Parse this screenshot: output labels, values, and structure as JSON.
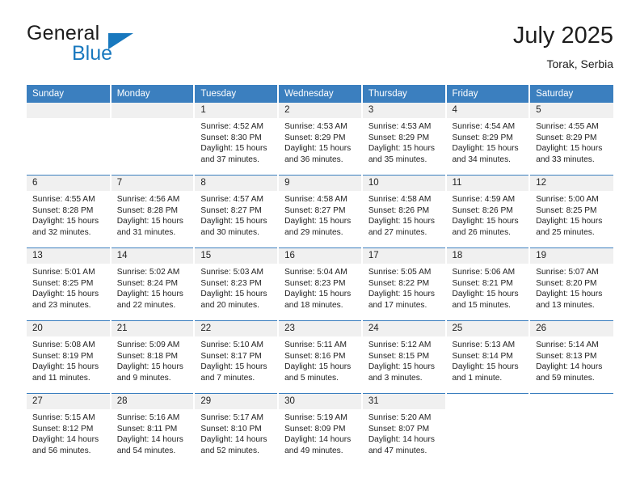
{
  "brand": {
    "name_part1": "General",
    "name_part2": "Blue",
    "accent_color": "#1878be"
  },
  "header": {
    "title": "July 2025",
    "location": "Torak, Serbia",
    "header_bg": "#3b7fbf",
    "daynum_bg": "#f0f0f0"
  },
  "weekdays": [
    "Sunday",
    "Monday",
    "Tuesday",
    "Wednesday",
    "Thursday",
    "Friday",
    "Saturday"
  ],
  "labels": {
    "sunrise": "Sunrise:",
    "sunset": "Sunset:",
    "daylight": "Daylight:"
  },
  "weeks": [
    [
      {
        "day": "",
        "sunrise": "",
        "sunset": "",
        "daylight": "",
        "empty": true
      },
      {
        "day": "",
        "sunrise": "",
        "sunset": "",
        "daylight": "",
        "empty": true
      },
      {
        "day": "1",
        "sunrise": "Sunrise: 4:52 AM",
        "sunset": "Sunset: 8:30 PM",
        "daylight": "Daylight: 15 hours and 37 minutes."
      },
      {
        "day": "2",
        "sunrise": "Sunrise: 4:53 AM",
        "sunset": "Sunset: 8:29 PM",
        "daylight": "Daylight: 15 hours and 36 minutes."
      },
      {
        "day": "3",
        "sunrise": "Sunrise: 4:53 AM",
        "sunset": "Sunset: 8:29 PM",
        "daylight": "Daylight: 15 hours and 35 minutes."
      },
      {
        "day": "4",
        "sunrise": "Sunrise: 4:54 AM",
        "sunset": "Sunset: 8:29 PM",
        "daylight": "Daylight: 15 hours and 34 minutes."
      },
      {
        "day": "5",
        "sunrise": "Sunrise: 4:55 AM",
        "sunset": "Sunset: 8:29 PM",
        "daylight": "Daylight: 15 hours and 33 minutes."
      }
    ],
    [
      {
        "day": "6",
        "sunrise": "Sunrise: 4:55 AM",
        "sunset": "Sunset: 8:28 PM",
        "daylight": "Daylight: 15 hours and 32 minutes."
      },
      {
        "day": "7",
        "sunrise": "Sunrise: 4:56 AM",
        "sunset": "Sunset: 8:28 PM",
        "daylight": "Daylight: 15 hours and 31 minutes."
      },
      {
        "day": "8",
        "sunrise": "Sunrise: 4:57 AM",
        "sunset": "Sunset: 8:27 PM",
        "daylight": "Daylight: 15 hours and 30 minutes."
      },
      {
        "day": "9",
        "sunrise": "Sunrise: 4:58 AM",
        "sunset": "Sunset: 8:27 PM",
        "daylight": "Daylight: 15 hours and 29 minutes."
      },
      {
        "day": "10",
        "sunrise": "Sunrise: 4:58 AM",
        "sunset": "Sunset: 8:26 PM",
        "daylight": "Daylight: 15 hours and 27 minutes."
      },
      {
        "day": "11",
        "sunrise": "Sunrise: 4:59 AM",
        "sunset": "Sunset: 8:26 PM",
        "daylight": "Daylight: 15 hours and 26 minutes."
      },
      {
        "day": "12",
        "sunrise": "Sunrise: 5:00 AM",
        "sunset": "Sunset: 8:25 PM",
        "daylight": "Daylight: 15 hours and 25 minutes."
      }
    ],
    [
      {
        "day": "13",
        "sunrise": "Sunrise: 5:01 AM",
        "sunset": "Sunset: 8:25 PM",
        "daylight": "Daylight: 15 hours and 23 minutes."
      },
      {
        "day": "14",
        "sunrise": "Sunrise: 5:02 AM",
        "sunset": "Sunset: 8:24 PM",
        "daylight": "Daylight: 15 hours and 22 minutes."
      },
      {
        "day": "15",
        "sunrise": "Sunrise: 5:03 AM",
        "sunset": "Sunset: 8:23 PM",
        "daylight": "Daylight: 15 hours and 20 minutes."
      },
      {
        "day": "16",
        "sunrise": "Sunrise: 5:04 AM",
        "sunset": "Sunset: 8:23 PM",
        "daylight": "Daylight: 15 hours and 18 minutes."
      },
      {
        "day": "17",
        "sunrise": "Sunrise: 5:05 AM",
        "sunset": "Sunset: 8:22 PM",
        "daylight": "Daylight: 15 hours and 17 minutes."
      },
      {
        "day": "18",
        "sunrise": "Sunrise: 5:06 AM",
        "sunset": "Sunset: 8:21 PM",
        "daylight": "Daylight: 15 hours and 15 minutes."
      },
      {
        "day": "19",
        "sunrise": "Sunrise: 5:07 AM",
        "sunset": "Sunset: 8:20 PM",
        "daylight": "Daylight: 15 hours and 13 minutes."
      }
    ],
    [
      {
        "day": "20",
        "sunrise": "Sunrise: 5:08 AM",
        "sunset": "Sunset: 8:19 PM",
        "daylight": "Daylight: 15 hours and 11 minutes."
      },
      {
        "day": "21",
        "sunrise": "Sunrise: 5:09 AM",
        "sunset": "Sunset: 8:18 PM",
        "daylight": "Daylight: 15 hours and 9 minutes."
      },
      {
        "day": "22",
        "sunrise": "Sunrise: 5:10 AM",
        "sunset": "Sunset: 8:17 PM",
        "daylight": "Daylight: 15 hours and 7 minutes."
      },
      {
        "day": "23",
        "sunrise": "Sunrise: 5:11 AM",
        "sunset": "Sunset: 8:16 PM",
        "daylight": "Daylight: 15 hours and 5 minutes."
      },
      {
        "day": "24",
        "sunrise": "Sunrise: 5:12 AM",
        "sunset": "Sunset: 8:15 PM",
        "daylight": "Daylight: 15 hours and 3 minutes."
      },
      {
        "day": "25",
        "sunrise": "Sunrise: 5:13 AM",
        "sunset": "Sunset: 8:14 PM",
        "daylight": "Daylight: 15 hours and 1 minute."
      },
      {
        "day": "26",
        "sunrise": "Sunrise: 5:14 AM",
        "sunset": "Sunset: 8:13 PM",
        "daylight": "Daylight: 14 hours and 59 minutes."
      }
    ],
    [
      {
        "day": "27",
        "sunrise": "Sunrise: 5:15 AM",
        "sunset": "Sunset: 8:12 PM",
        "daylight": "Daylight: 14 hours and 56 minutes."
      },
      {
        "day": "28",
        "sunrise": "Sunrise: 5:16 AM",
        "sunset": "Sunset: 8:11 PM",
        "daylight": "Daylight: 14 hours and 54 minutes."
      },
      {
        "day": "29",
        "sunrise": "Sunrise: 5:17 AM",
        "sunset": "Sunset: 8:10 PM",
        "daylight": "Daylight: 14 hours and 52 minutes."
      },
      {
        "day": "30",
        "sunrise": "Sunrise: 5:19 AM",
        "sunset": "Sunset: 8:09 PM",
        "daylight": "Daylight: 14 hours and 49 minutes."
      },
      {
        "day": "31",
        "sunrise": "Sunrise: 5:20 AM",
        "sunset": "Sunset: 8:07 PM",
        "daylight": "Daylight: 14 hours and 47 minutes."
      },
      {
        "day": "",
        "sunrise": "",
        "sunset": "",
        "daylight": "",
        "empty": true,
        "trailing": true
      },
      {
        "day": "",
        "sunrise": "",
        "sunset": "",
        "daylight": "",
        "empty": true,
        "trailing": true
      }
    ]
  ]
}
